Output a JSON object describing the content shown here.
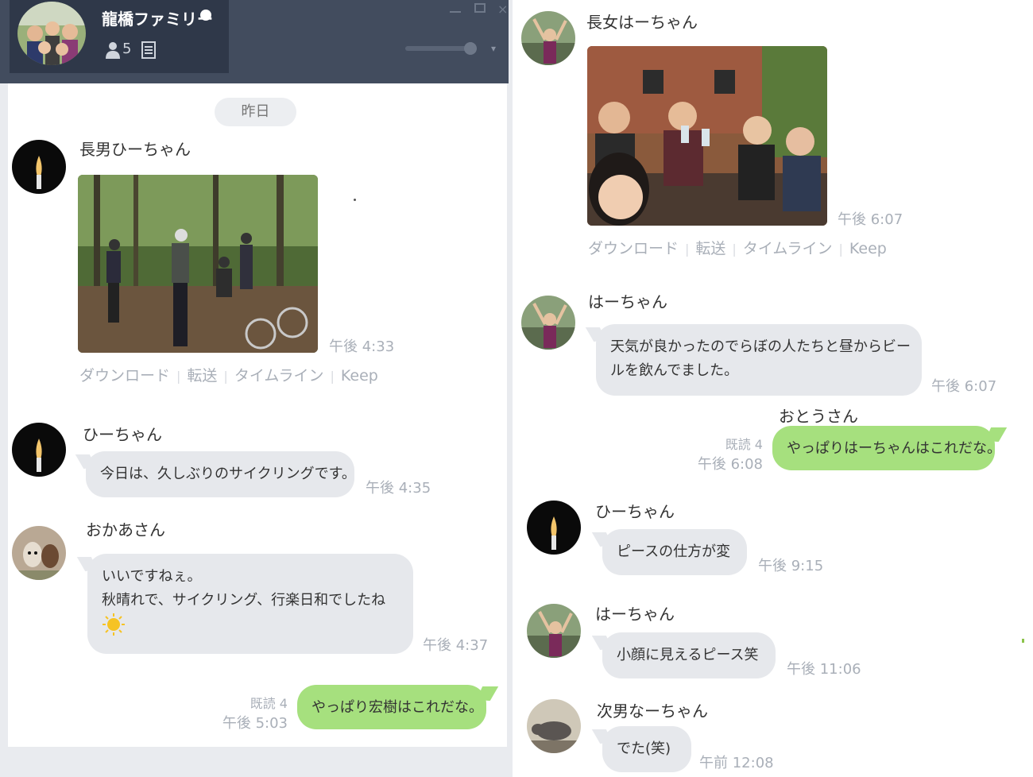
{
  "group": {
    "title": "龍橋ファミリー",
    "member_count": "5"
  },
  "left": {
    "date_separator": "昨日",
    "messages": [
      {
        "sender": "長男ひーちゃん",
        "time": "午後 4:33"
      },
      {
        "sender": "ひーちゃん",
        "text": "今日は、久しぶりのサイクリングです。",
        "time": "午後 4:35"
      },
      {
        "sender": "おかあさん",
        "line1": "いいですねぇ。",
        "line2": "秋晴れで、サイクリング、行楽日和でしたね",
        "time": "午後 4:37"
      },
      {
        "text": "やっぱり宏樹はこれだな。",
        "read": "既読 4",
        "time": "午後 5:03"
      }
    ]
  },
  "right": {
    "messages": [
      {
        "sender": "長女はーちゃん",
        "time": "午後 6:07"
      },
      {
        "sender": "はーちゃん",
        "line1": "天気が良かったのでらぼの人たちと昼からビー",
        "line2": "ルを飲んでました。",
        "time": "午後 6:07"
      },
      {
        "sender": "おとうさん",
        "text": "やっぱりはーちゃんはこれだな。",
        "read": "既読 4",
        "time": "午後 6:08"
      },
      {
        "sender": "ひーちゃん",
        "text": "ピースの仕方が変",
        "time": "午後 9:15"
      },
      {
        "sender": "はーちゃん",
        "text": "小顔に見えるピース笑",
        "time": "午後 11:06"
      },
      {
        "sender": "次男なーちゃん",
        "text": "でた(笑)",
        "time": "午前 12:08"
      }
    ]
  },
  "image_actions": {
    "download": "ダウンロード",
    "forward": "転送",
    "timeline": "タイムライン",
    "keep": "Keep"
  },
  "colors": {
    "header": "#424c5e",
    "my_bubble": "#a6e07e",
    "other_bubble": "#e6e8ec",
    "meta_text": "#a9afb8"
  }
}
